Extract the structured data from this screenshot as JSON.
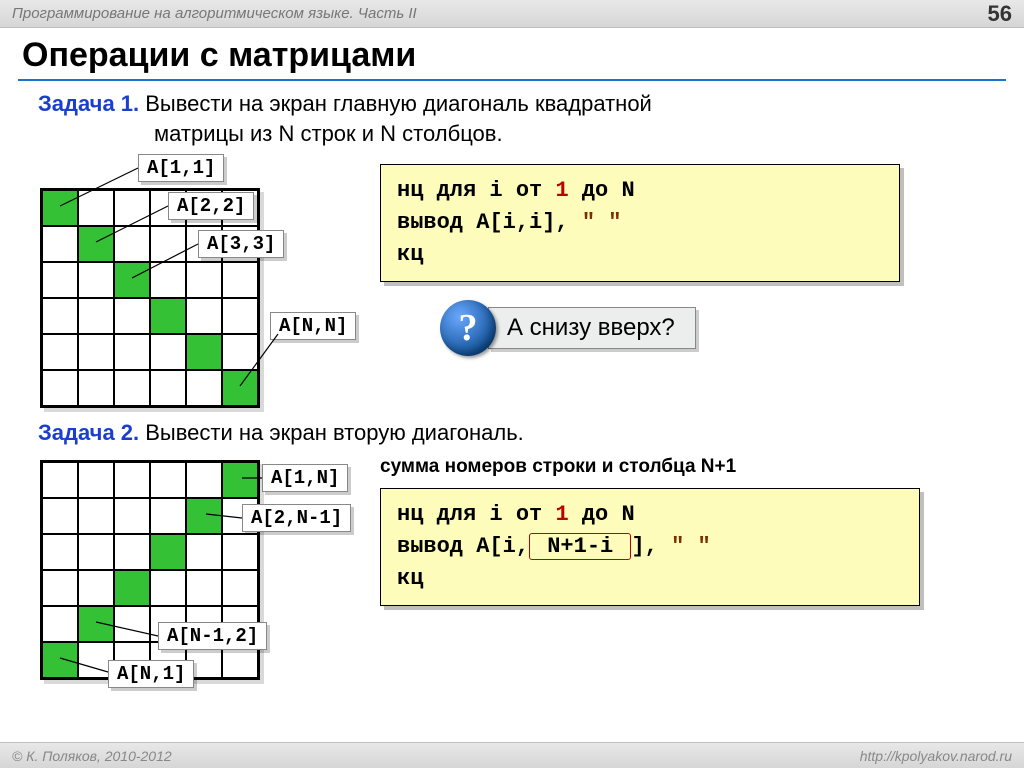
{
  "header": {
    "title": "Программирование на алгоритмическом языке. Часть II",
    "page": "56"
  },
  "slide_title": "Операции с матрицами",
  "task1": {
    "label": "Задача 1.",
    "text_l1": " Вывести на экран главную диагональ квадратной",
    "text_l2": "матрицы из N строк и N столбцов."
  },
  "labels1": {
    "a11": "A[1,1]",
    "a22": "A[2,2]",
    "a33": "A[3,3]",
    "ann": "A[N,N]"
  },
  "code1": {
    "l1a": "нц для i от ",
    "l1_one": "1",
    "l1b": " до N",
    "l2a": "  вывод A[i,i], ",
    "l2_str": "\" \"",
    "l3": "кц"
  },
  "question": "А снизу вверх?",
  "task2": {
    "label": "Задача 2.",
    "text": " Вывести на экран вторую диагональ."
  },
  "labels2": {
    "a1n": "A[1,N]",
    "a2n1": "A[2,N-1]",
    "an12": "A[N-1,2]",
    "an1": "A[N,1]"
  },
  "note2": "сумма номеров строки и столбца N+1",
  "code2": {
    "l1a": "нц для i от ",
    "l1_one": "1",
    "l1b": " до N",
    "l2a": "  вывод A[i,",
    "l2_hl": " N+1-i ",
    "l2b": "], ",
    "l2_str": "\" \"",
    "l3": "кц"
  },
  "footer": {
    "left": "© К. Поляков, 2010-2012",
    "right": "http://kpolyakov.narod.ru"
  }
}
